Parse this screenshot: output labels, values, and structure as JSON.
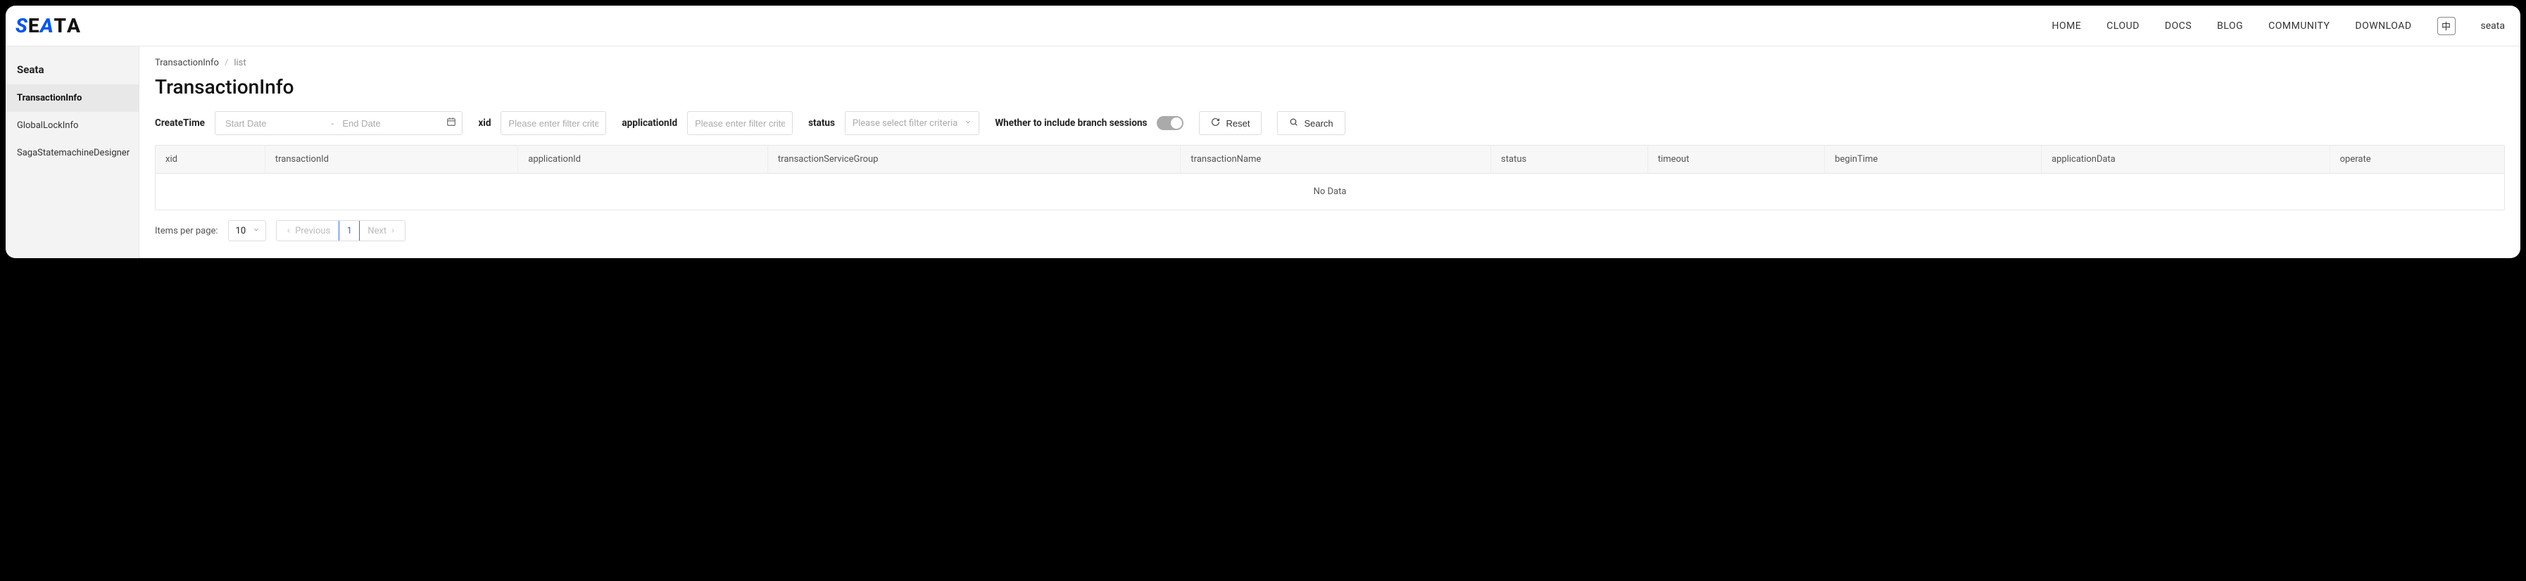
{
  "brand": "SEATA",
  "nav": {
    "items": [
      "HOME",
      "CLOUD",
      "DOCS",
      "BLOG",
      "COMMUNITY",
      "DOWNLOAD"
    ],
    "lang": "中",
    "user": "seata"
  },
  "sidebar": {
    "title": "Seata",
    "items": [
      {
        "label": "TransactionInfo",
        "active": true
      },
      {
        "label": "GlobalLockInfo",
        "active": false
      },
      {
        "label": "SagaStatemachineDesigner",
        "active": false
      }
    ]
  },
  "breadcrumb": {
    "root": "TransactionInfo",
    "leaf": "list"
  },
  "page_title": "TransactionInfo",
  "filters": {
    "createTime": {
      "label": "CreateTime",
      "start_ph": "Start Date",
      "end_ph": "End Date"
    },
    "xid": {
      "label": "xid",
      "placeholder": "Please enter filter criteri"
    },
    "applicationId": {
      "label": "applicationId",
      "placeholder": "Please enter filter criteri"
    },
    "status": {
      "label": "status",
      "placeholder": "Please select filter criteria"
    },
    "branchToggle": {
      "label": "Whether to include branch sessions"
    },
    "reset": "Reset",
    "search": "Search"
  },
  "table": {
    "columns": [
      "xid",
      "transactionId",
      "applicationId",
      "transactionServiceGroup",
      "transactionName",
      "status",
      "timeout",
      "beginTime",
      "applicationData",
      "operate"
    ],
    "no_data": "No Data"
  },
  "pagination": {
    "items_per_page_label": "Items per page:",
    "per_page": "10",
    "previous": "Previous",
    "current": "1",
    "next": "Next"
  }
}
